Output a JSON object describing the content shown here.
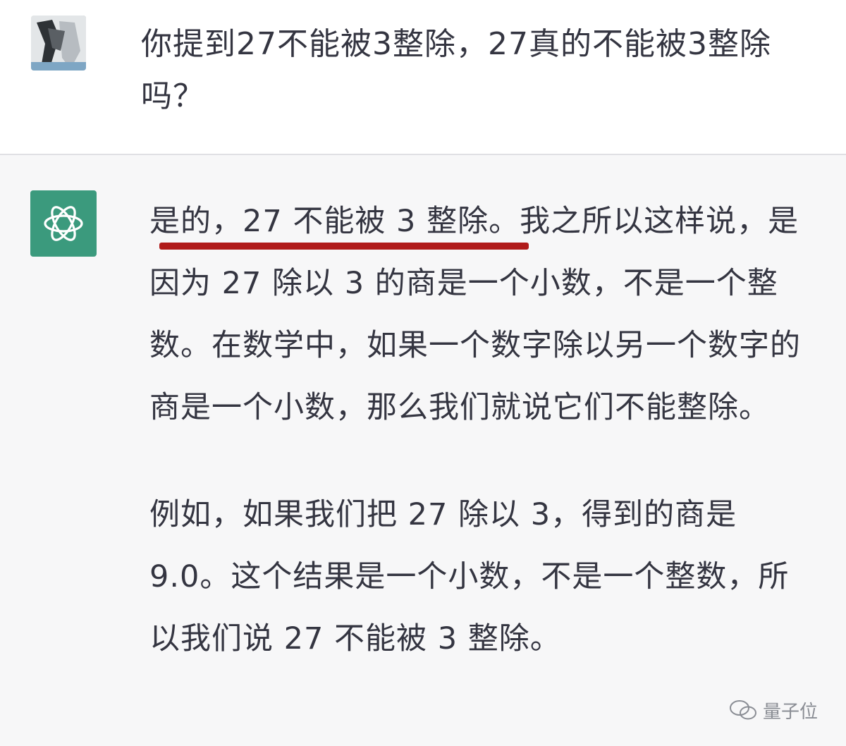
{
  "user_message": {
    "avatar_icon": "user-avatar-photo",
    "text": "你提到27不能被3整除，27真的不能被3整除吗？"
  },
  "assistant_message": {
    "avatar_icon": "openai-logo-icon",
    "paragraph_1_highlight": "是的，27 不能被 3 整除。",
    "paragraph_1_rest": "我之所以这样说，是因为 27 除以 3 的商是一个小数，不是一个整数。在数学中，如果一个数字除以另一个数字的商是一个小数，那么我们就说它们不能整除。",
    "paragraph_2": "例如，如果我们把 27 除以 3，得到的商是 9.0。这个结果是一个小数，不是一个整数，所以我们说 27 不能被 3 整除。"
  },
  "watermark": {
    "icon": "wechat-icon",
    "text": "量子位"
  },
  "colors": {
    "assistant_avatar_bg": "#3b9a7d",
    "underline": "#b01a1a"
  }
}
